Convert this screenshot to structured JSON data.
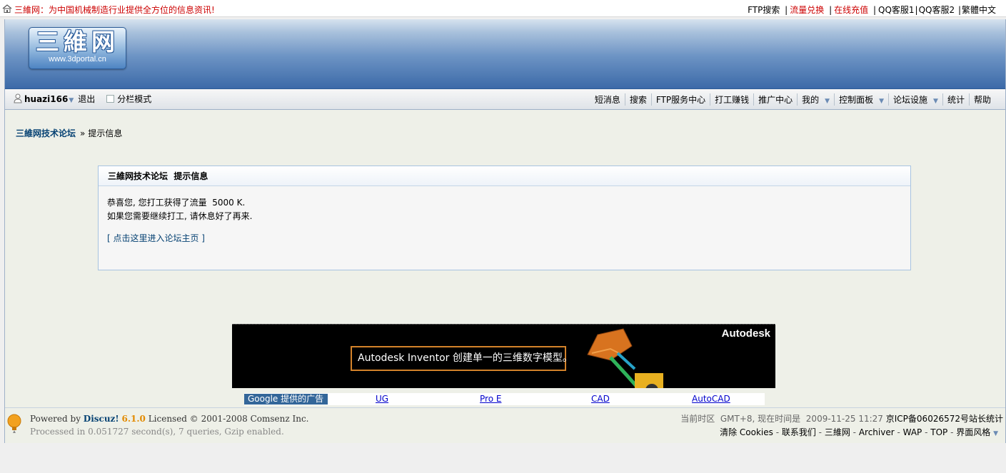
{
  "top": {
    "slogan": "三維网：为中国机械制造行业提供全方位的信息资讯!",
    "links": [
      {
        "label": "FTP搜索",
        "color": "black"
      },
      {
        "label": "流量兑换",
        "color": "red"
      },
      {
        "label": "在线充值",
        "color": "red"
      },
      {
        "label": "QQ客服1",
        "color": "black"
      },
      {
        "label": "QQ客服2",
        "color": "black"
      },
      {
        "label": "繁體中文",
        "color": "black"
      }
    ]
  },
  "logo": {
    "title": "三維网",
    "url": "www.3dportal.cn"
  },
  "userbar": {
    "username": "huazi166",
    "logout": "退出",
    "split_mode": "分栏模式"
  },
  "nav": [
    {
      "label": "短消息",
      "dropdown": false
    },
    {
      "label": "搜索",
      "dropdown": false
    },
    {
      "label": "FTP服务中心",
      "dropdown": false
    },
    {
      "label": "打工赚钱",
      "dropdown": false
    },
    {
      "label": "推广中心",
      "dropdown": false
    },
    {
      "label": "我的",
      "dropdown": true
    },
    {
      "label": "控制面板",
      "dropdown": true
    },
    {
      "label": "论坛设施",
      "dropdown": true
    },
    {
      "label": "统计",
      "dropdown": false
    },
    {
      "label": "帮助",
      "dropdown": false
    }
  ],
  "breadcrumb": {
    "forum": "三維网技术论坛",
    "sep": "»",
    "current": "提示信息"
  },
  "message": {
    "header": "三維网技术论坛  提示信息",
    "line1": "恭喜您, 您打工获得了流量  5000 K.",
    "line2": "如果您需要继续打工, 请休息好了再来.",
    "home_link": "[ 点击这里进入论坛主页 ]"
  },
  "ad": {
    "brand": "Autodesk",
    "text": "Autodesk Inventor 创建单一的三维数字模型。"
  },
  "google_ads": {
    "label": "Google 提供的广告",
    "links": [
      "UG",
      "Pro E",
      "CAD",
      "AutoCAD"
    ]
  },
  "footer": {
    "powered_prefix": "Powered by ",
    "discuz": "Discuz!",
    "version": "6.1.0",
    "license": " Licensed © 2001-2008 Comsenz Inc.",
    "processed": "Processed in 0.051727 second(s), 7 queries, Gzip enabled.",
    "time_info": "当前时区  GMT+8, 现在时间是  2009-11-25 11:27",
    "icp": "京ICP备06026572号站长统计",
    "links": [
      "清除 Cookies",
      "联系我们",
      "三維网",
      "Archiver",
      "WAP",
      "TOP",
      "界面风格"
    ]
  },
  "colors": {
    "accent_red": "#cc0000",
    "link_blue": "#064273",
    "banner_blue": "#3c6aa8",
    "google_label_bg": "#336699"
  }
}
